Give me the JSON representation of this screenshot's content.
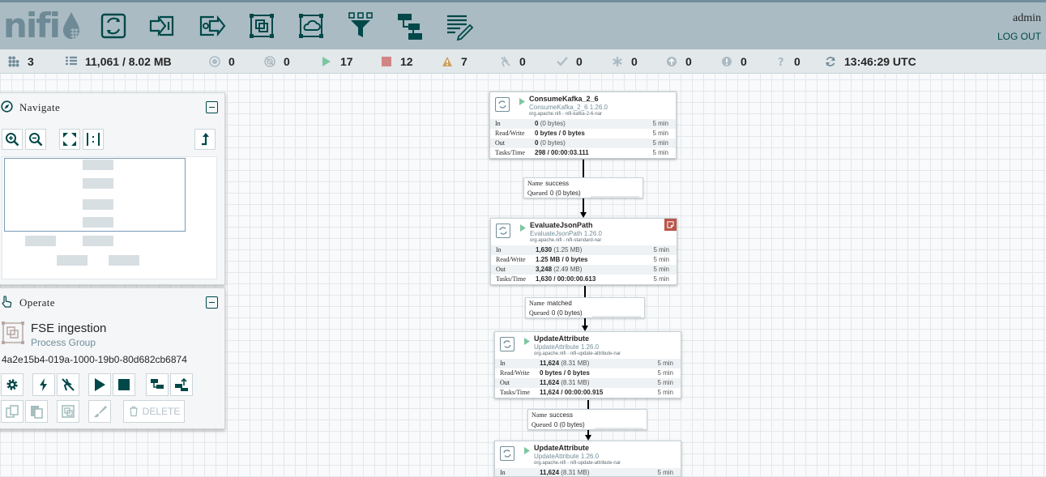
{
  "header": {
    "logo_text": "nifi",
    "user": "admin",
    "logout_label": "LOG OUT",
    "tools": [
      "processor-icon",
      "input-port-icon",
      "output-port-icon",
      "process-group-icon",
      "remote-process-group-icon",
      "funnel-icon",
      "template-icon",
      "label-icon"
    ]
  },
  "status": {
    "active_threads": "3",
    "queued": "11,061 / 8.02 MB",
    "transmitting": "0",
    "not_transmitting": "0",
    "running": "17",
    "stopped": "12",
    "invalid": "7",
    "disabled": "0",
    "up_to_date": "0",
    "locally_modified": "0",
    "stale": "0",
    "locally_modified_stale": "0",
    "sync_failure": "0",
    "refreshed": "13:46:29 UTC"
  },
  "navigate": {
    "title": "Navigate"
  },
  "operate": {
    "title": "Operate",
    "selection_name": "FSE ingestion",
    "selection_type": "Process Group",
    "selection_id": "4a2e15b4-019a-1000-19b0-80d682cb6874",
    "delete_label": "DELETE"
  },
  "labels": {
    "in": "In",
    "rw": "Read/Write",
    "out": "Out",
    "tasks": "Tasks/Time",
    "name": "Name",
    "queued": "Queued"
  },
  "processors": [
    {
      "name": "ConsumeKafka_2_6",
      "type": "ConsumeKafka_2_6 1.26.0",
      "bundle": "org.apache.nifi - nifi-kafka-2-6-nar",
      "in": "0",
      "in_detail": "(0 bytes)",
      "rw": "0 bytes / 0 bytes",
      "out": "0",
      "out_detail": "(0 bytes)",
      "tasks": "298 / 00:00:03.111",
      "window": "5 min"
    },
    {
      "name": "EvaluateJsonPath",
      "type": "EvaluateJsonPath 1.26.0",
      "bundle": "org.apache.nifi - nifi-standard-nar",
      "in": "1,630",
      "in_detail": "(1.25 MB)",
      "rw": "1.25 MB / 0 bytes",
      "out": "3,248",
      "out_detail": "(2.49 MB)",
      "tasks": "1,630 / 00:00:00.613",
      "window": "5 min"
    },
    {
      "name": "UpdateAttribute",
      "type": "UpdateAttribute 1.26.0",
      "bundle": "org.apache.nifi - nifi-update-attribute-nar",
      "in": "11,624",
      "in_detail": "(8.31 MB)",
      "rw": "0 bytes / 0 bytes",
      "out": "11,624",
      "out_detail": "(8.31 MB)",
      "tasks": "11,624 / 00:00:00.915",
      "window": "5 min"
    },
    {
      "name": "UpdateAttribute",
      "type": "UpdateAttribute 1.26.0",
      "bundle": "org.apache.nifi - nifi-update-attribute-nar",
      "in": "11,624",
      "in_detail": "(8.31 MB)",
      "window": "5 min"
    }
  ],
  "connections": [
    {
      "name": "success",
      "queued": "0 (0 bytes)"
    },
    {
      "name": "matched",
      "queued": "0 (0 bytes)"
    },
    {
      "name": "success",
      "queued": "0 (0 bytes)"
    }
  ]
}
